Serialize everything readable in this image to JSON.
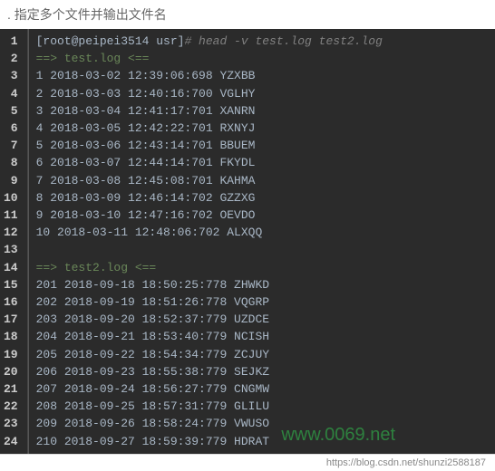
{
  "title": ". 指定多个文件并输出文件名",
  "prompt": {
    "bracket": "[root@peipei3514 usr]",
    "hash": "#",
    "command": " head -v test.log test2.log"
  },
  "gutter": [
    "1",
    "2",
    "3",
    "4",
    "5",
    "6",
    "7",
    "8",
    "9",
    "10",
    "11",
    "12",
    "13",
    "14",
    "15",
    "16",
    "17",
    "18",
    "19",
    "20",
    "21",
    "22",
    "23",
    "24"
  ],
  "sections": [
    {
      "header": "==> test.log <==",
      "rows": [
        "1 2018-03-02 12:39:06:698 YZXBB",
        "2 2018-03-03 12:40:16:700 VGLHY",
        "3 2018-03-04 12:41:17:701 XANRN",
        "4 2018-03-05 12:42:22:701 RXNYJ",
        "5 2018-03-06 12:43:14:701 BBUEM",
        "6 2018-03-07 12:44:14:701 FKYDL",
        "7 2018-03-08 12:45:08:701 KAHMA",
        "8 2018-03-09 12:46:14:702 GZZXG",
        "9 2018-03-10 12:47:16:702 OEVDO",
        "10 2018-03-11 12:48:06:702 ALXQQ"
      ]
    },
    {
      "header": "==> test2.log <==",
      "rows": [
        "201 2018-09-18 18:50:25:778 ZHWKD",
        "202 2018-09-19 18:51:26:778 VQGRP",
        "203 2018-09-20 18:52:37:779 UZDCE",
        "204 2018-09-21 18:53:40:779 NCISH",
        "205 2018-09-22 18:54:34:779 ZCJUY",
        "206 2018-09-23 18:55:38:779 SEJKZ",
        "207 2018-09-24 18:56:27:779 CNGMW",
        "208 2018-09-25 18:57:31:779 GLILU",
        "209 2018-09-26 18:58:24:779 VWUSO",
        "210 2018-09-27 18:59:39:779 HDRAT"
      ]
    }
  ],
  "watermark": "www.0069.net",
  "footer": "https://blog.csdn.net/shunzi2588187"
}
